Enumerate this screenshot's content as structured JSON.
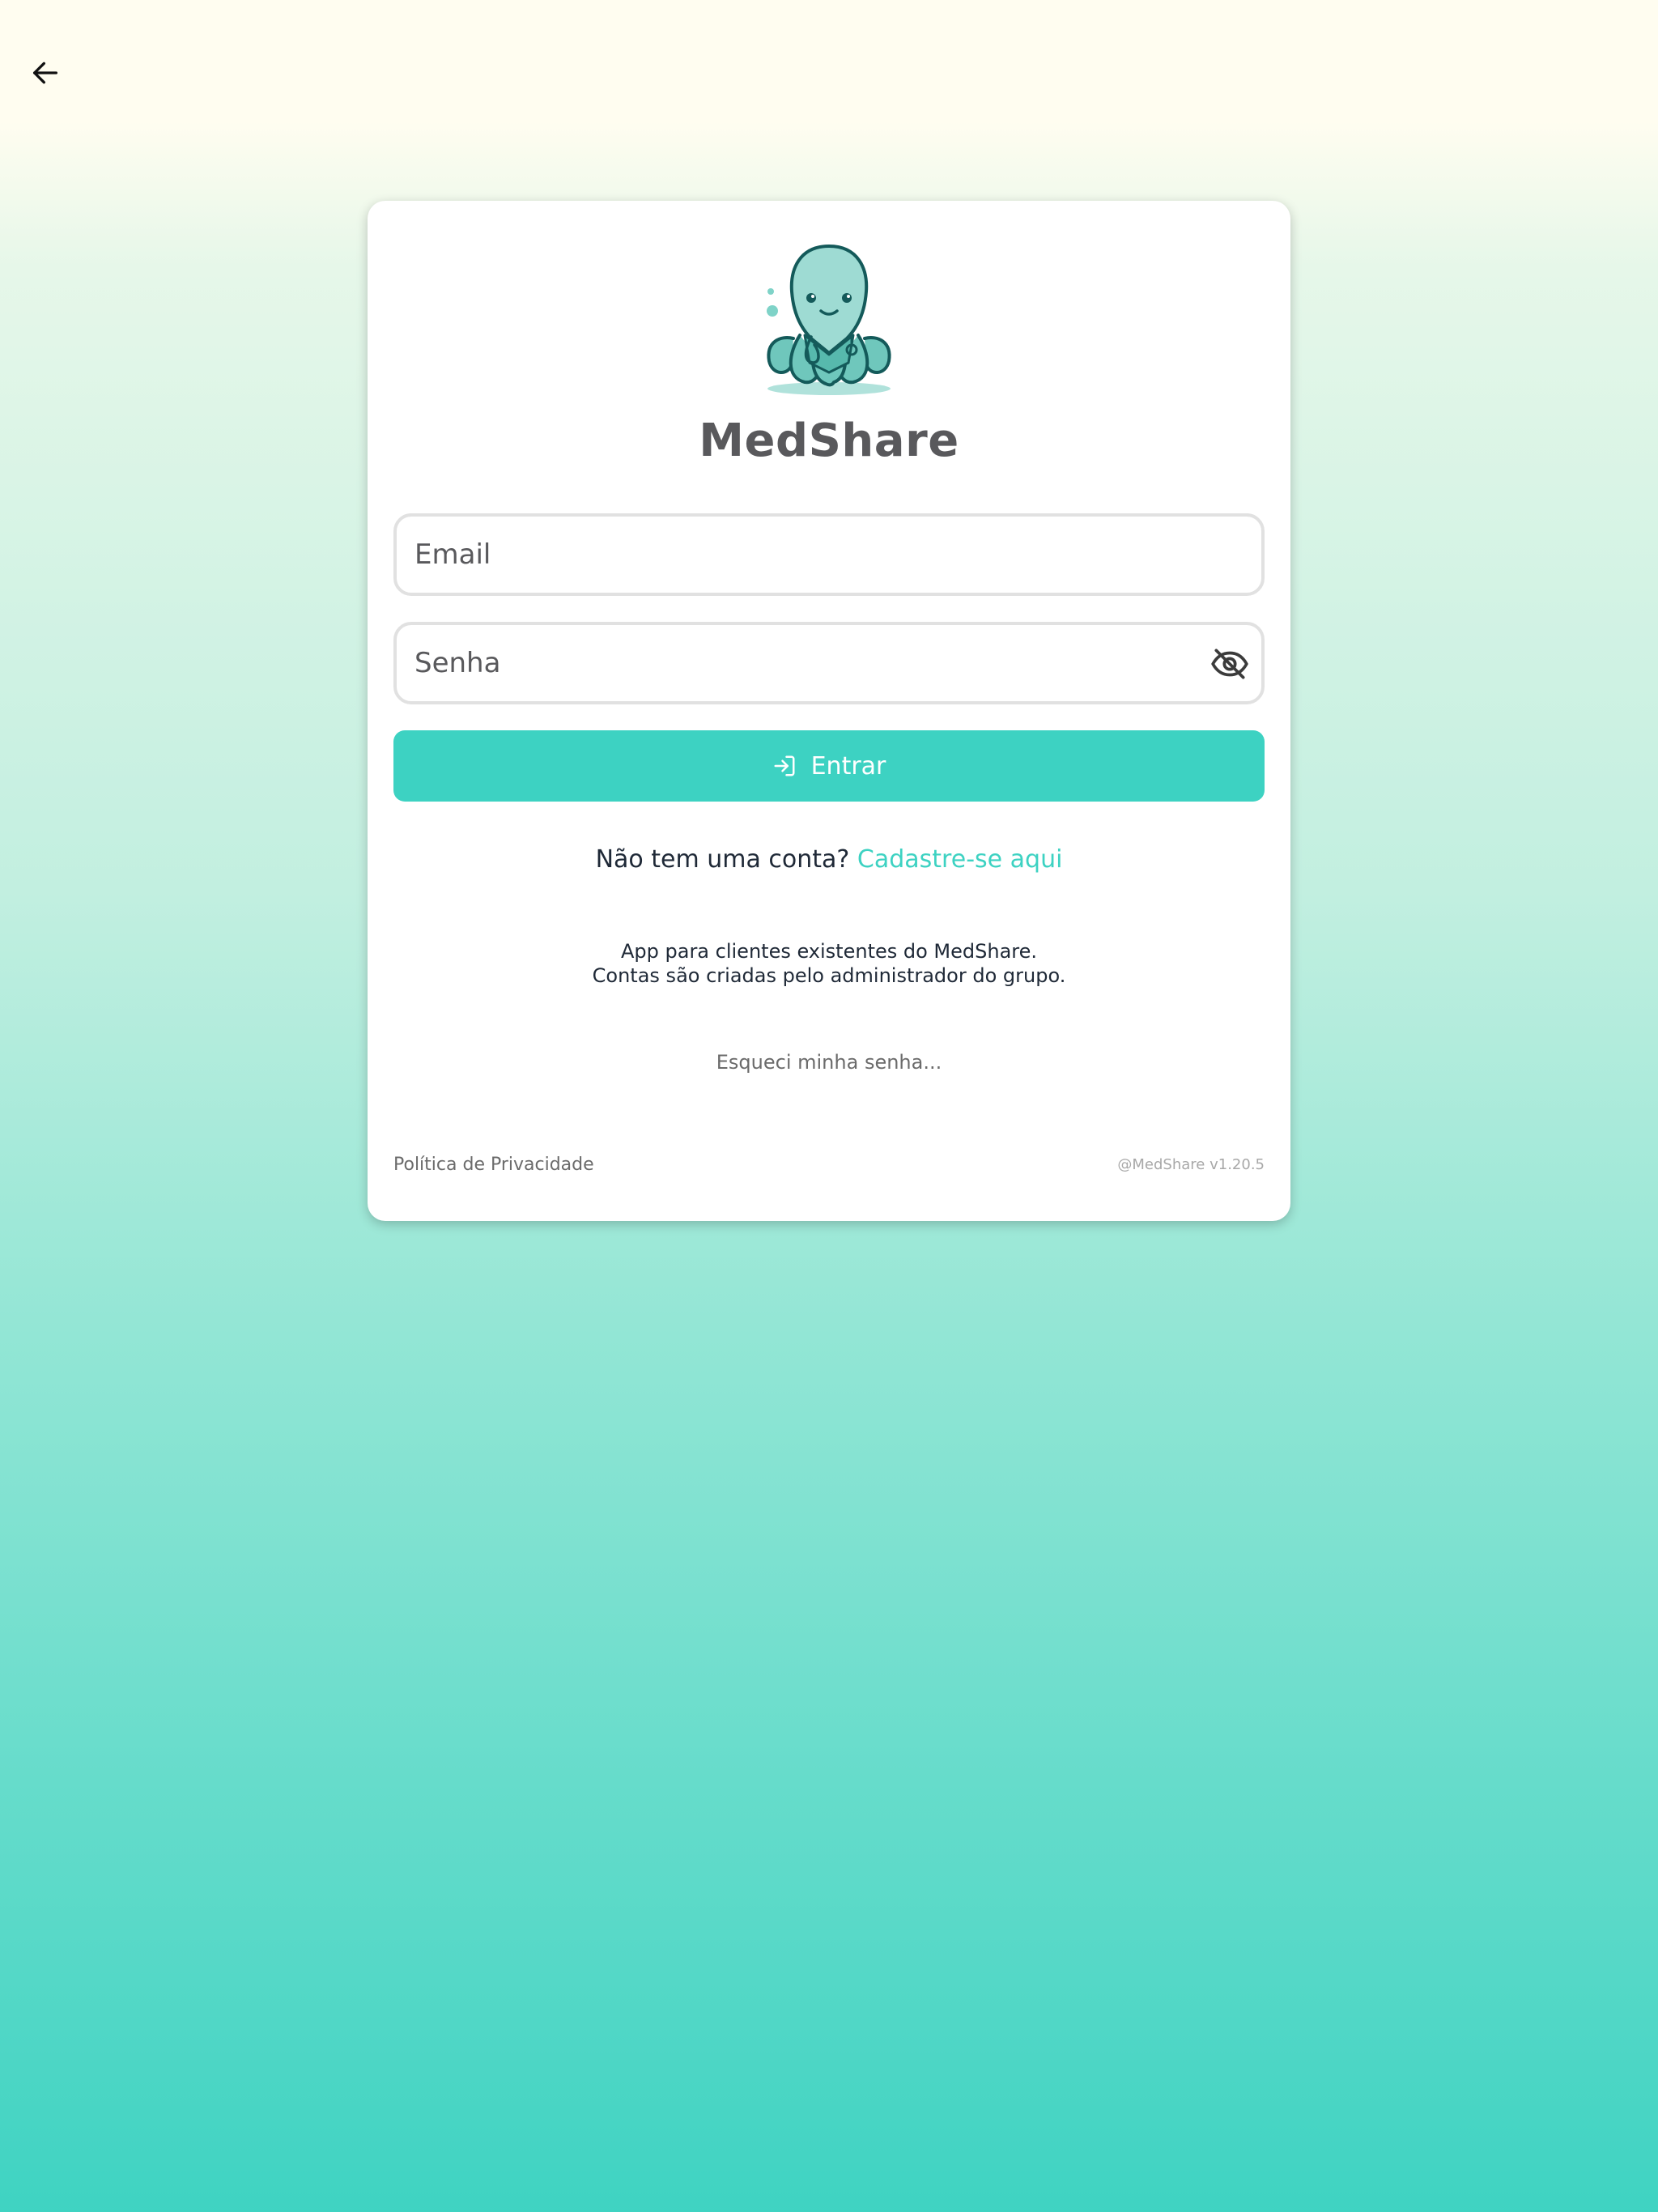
{
  "nav": {
    "back_icon": "arrow-left-icon"
  },
  "brand": {
    "logo_icon": "octopus-doctor-logo",
    "title": "MedShare"
  },
  "form": {
    "email_placeholder": "Email",
    "email_value": "",
    "password_placeholder": "Senha",
    "password_value": "",
    "password_toggle_icon": "eye-slash-icon",
    "login_icon": "login-arrow-icon",
    "login_label": "Entrar"
  },
  "signup": {
    "prompt": "Não tem uma conta?",
    "link": "Cadastre-se aqui"
  },
  "info": {
    "line1": "App para clientes existentes do MedShare.",
    "line2": "Contas são criadas pelo administrador do grupo."
  },
  "forgot_label": "Esqueci minha senha...",
  "footer": {
    "privacy": "Política de Privacidade",
    "version": "@MedShare v1.20.5"
  },
  "colors": {
    "accent": "#3dd2c2",
    "title": "#59595c",
    "background_top": "#fffdf0",
    "background_bottom": "#3fd3c2"
  }
}
